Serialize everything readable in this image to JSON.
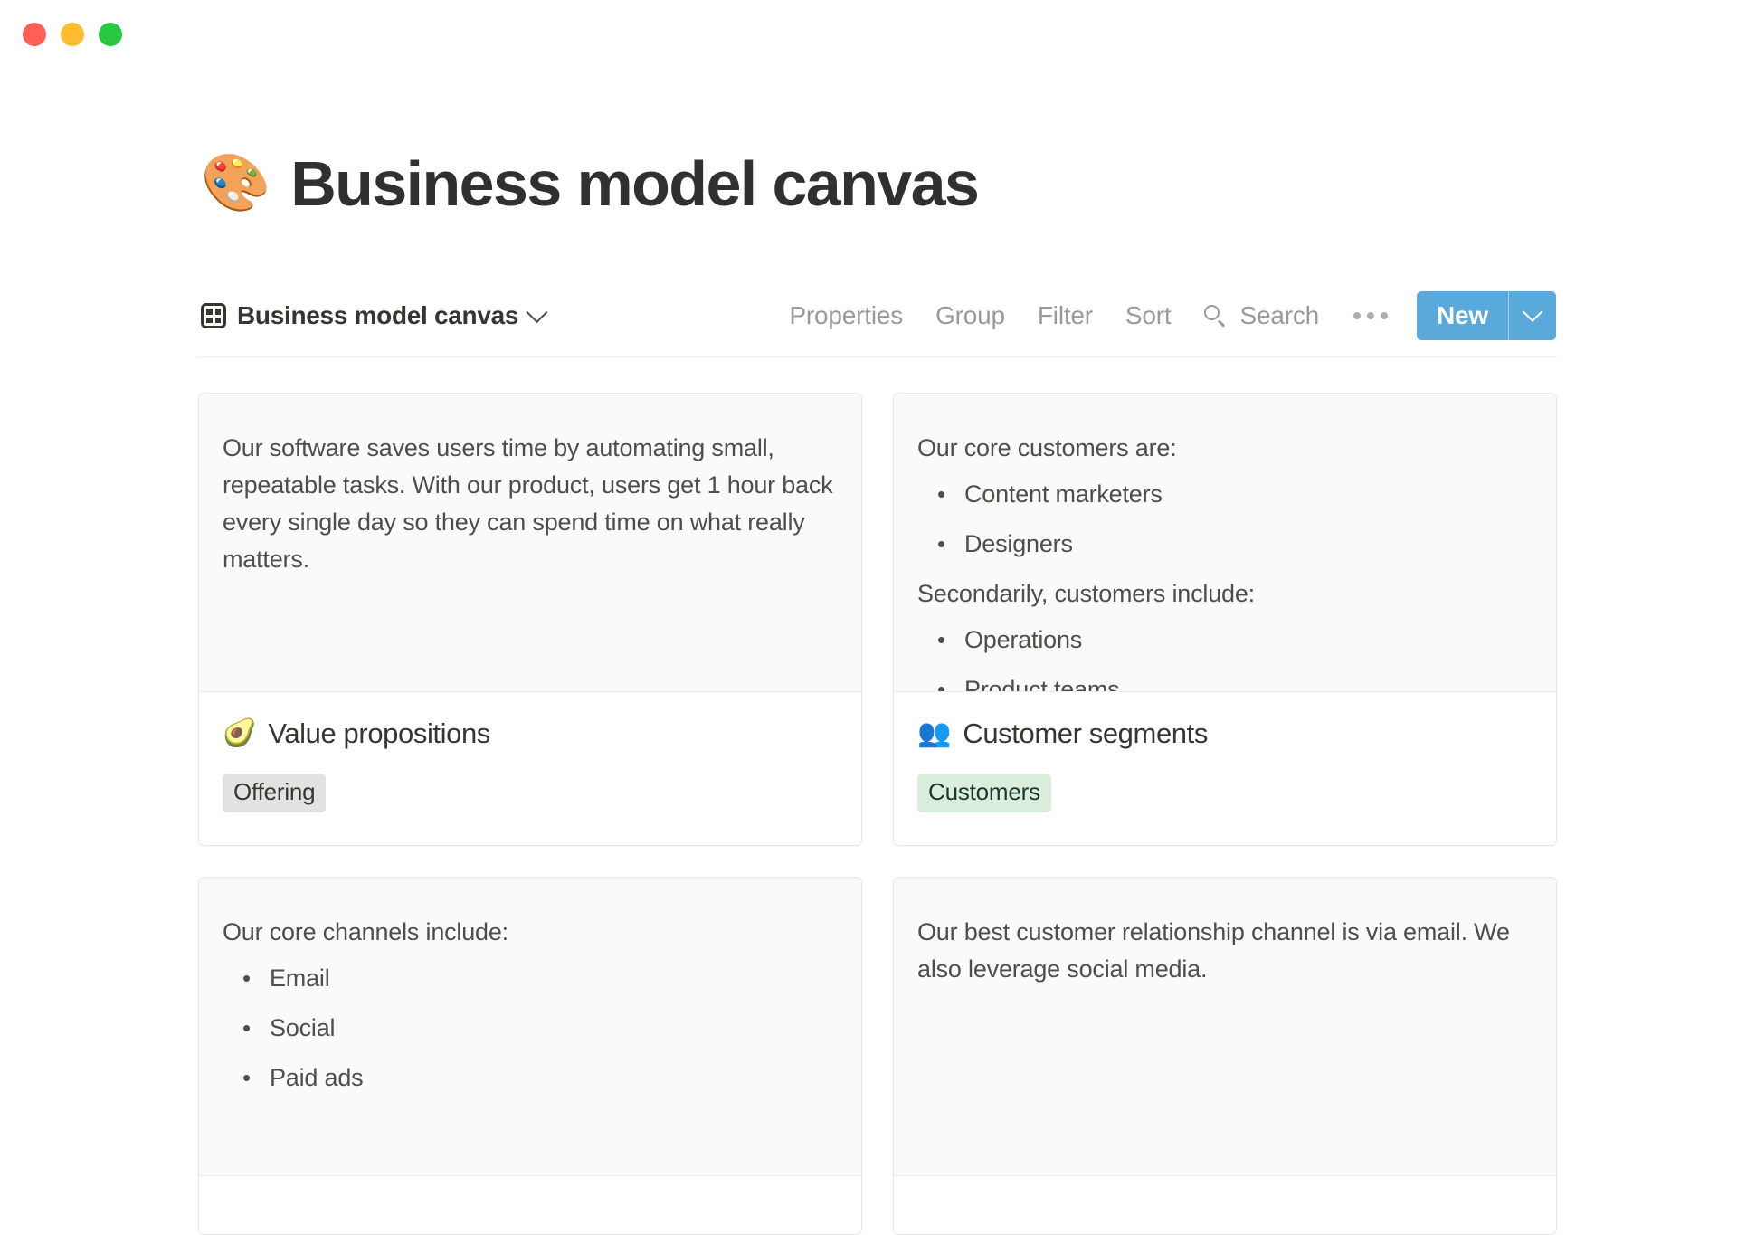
{
  "window": {
    "traffic_lights": [
      {
        "name": "close",
        "color": "#ff5f57"
      },
      {
        "name": "minimize",
        "color": "#febc2e"
      },
      {
        "name": "zoom",
        "color": "#28c840"
      }
    ]
  },
  "header": {
    "emoji": "🎨",
    "title": "Business model canvas"
  },
  "toolbar": {
    "view_icon": "gallery-icon",
    "view_name": "Business model canvas",
    "view_caret": "chevron-down-icon",
    "items": [
      {
        "label": "Properties"
      },
      {
        "label": "Group"
      },
      {
        "label": "Filter"
      },
      {
        "label": "Sort"
      }
    ],
    "search_label": "Search",
    "more_label": "•••",
    "new_label": "New",
    "new_color": "#5aa9db"
  },
  "cards": [
    {
      "preview": {
        "blocks": [
          {
            "type": "paragraph",
            "text": "Our software saves users time by automating small, repeatable tasks. With our product, users get 1 hour back every single day so they can spend time on what really matters."
          }
        ]
      },
      "emoji": "🥑",
      "title": "Value propositions",
      "tag": {
        "label": "Offering",
        "bg": "#e3e2e0",
        "color": "#37352f"
      }
    },
    {
      "preview": {
        "blocks": [
          {
            "type": "paragraph",
            "text": "Our core customers are:"
          },
          {
            "type": "list",
            "items": [
              "Content marketers",
              "Designers"
            ]
          },
          {
            "type": "paragraph",
            "text": "Secondarily, customers include:"
          },
          {
            "type": "list",
            "items": [
              "Operations",
              "Product teams"
            ]
          }
        ]
      },
      "emoji": "👥",
      "title": "Customer segments",
      "tag": {
        "label": "Customers",
        "bg": "#dbeddb",
        "color": "#1c3829"
      }
    },
    {
      "preview": {
        "blocks": [
          {
            "type": "paragraph",
            "text": "Our core channels include:"
          },
          {
            "type": "list",
            "items": [
              "Email",
              "Social",
              "Paid ads"
            ]
          }
        ]
      },
      "emoji": "",
      "title": "",
      "tag": null
    },
    {
      "preview": {
        "blocks": [
          {
            "type": "paragraph",
            "text": "Our best customer relationship channel is via email. We also leverage social media."
          }
        ]
      },
      "emoji": "",
      "title": "",
      "tag": null
    }
  ]
}
